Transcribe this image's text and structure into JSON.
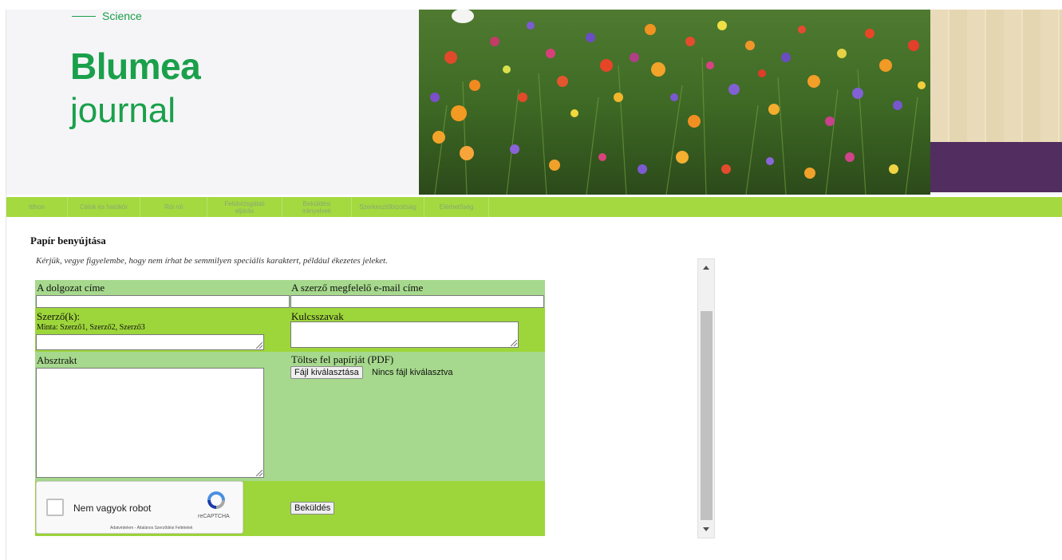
{
  "header": {
    "tagline": "Science",
    "brand_name": "Blumea",
    "brand_sub": "journal"
  },
  "nav": {
    "items": [
      {
        "label": "Itthon"
      },
      {
        "label": "Célok és hatókör"
      },
      {
        "label": "Rói rói"
      },
      {
        "label": "Felülvizsgálati eljárás"
      },
      {
        "label": "Beküldési irányelvek"
      },
      {
        "label": "Szerkesztőbizottság"
      },
      {
        "label": "Elérhetőség"
      }
    ]
  },
  "content": {
    "title": "Papír benyújtása",
    "note": "Kérjük, vegye figyelembe, hogy nem írhat be semmilyen speciális karaktert, például ékezetes jeleket."
  },
  "form": {
    "paper_title_label": "A dolgozat címe",
    "email_label": "A szerző megfelelő e-mail címe",
    "authors_label": "Szerző(k):",
    "authors_hint": "Minta: Szerző1, Szerző2, Szerző3",
    "keywords_label": "Kulcsszavak",
    "abstract_label": "Absztrakt",
    "upload_label": "Töltse fel papírját (PDF)",
    "choose_file_button": "Fájl kiválasztása",
    "file_status": "Nincs fájl kiválasztva",
    "submit_button": "Beküldés"
  },
  "captcha": {
    "label": "Nem vagyok robot",
    "brand": "reCAPTCHA",
    "links": "Adatvédelem - Általános Szerződési Feltételek"
  },
  "colors": {
    "brand_green": "#1aa04b",
    "nav_green": "#a4d940",
    "form_light": "#a6d98d",
    "form_bright": "#9dd63a",
    "purple_band": "#512e5f"
  }
}
